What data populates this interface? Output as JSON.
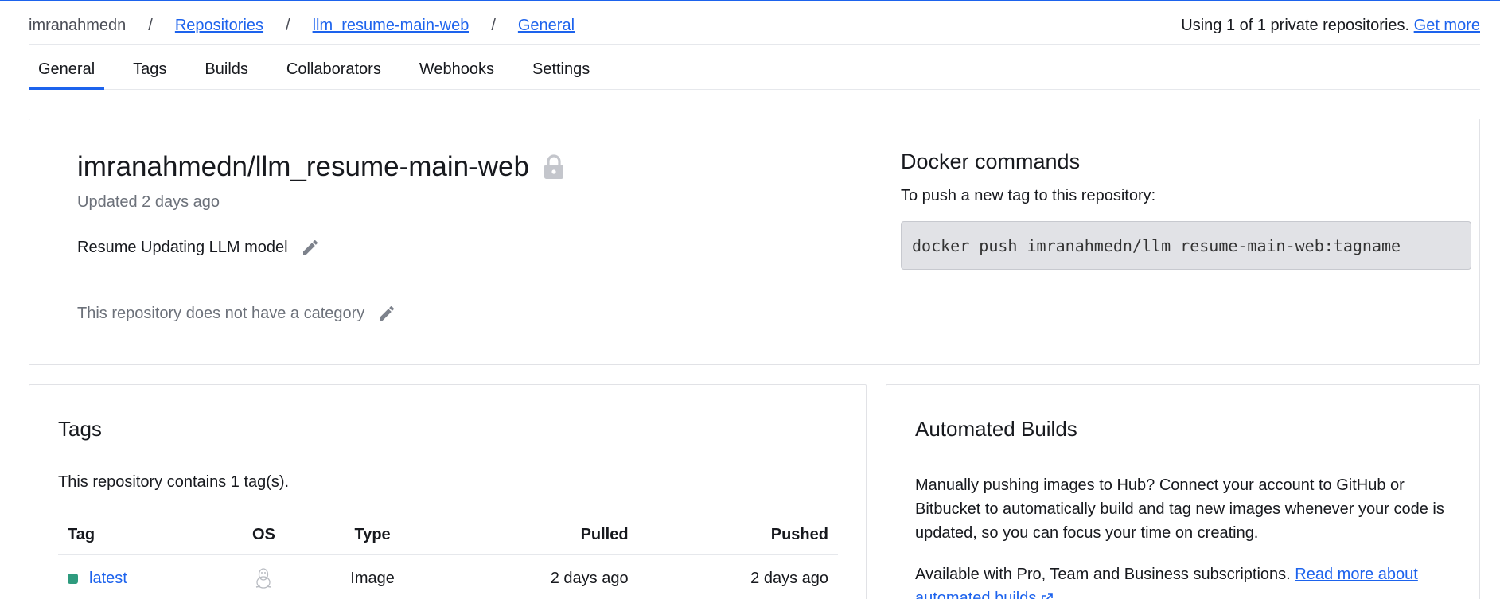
{
  "breadcrumb": {
    "user": "imranahmedn",
    "repositories": "Repositories",
    "repo": "llm_resume-main-web",
    "current": "General",
    "separator": "/"
  },
  "usage": {
    "text": "Using 1 of 1 private repositories.",
    "link": "Get more"
  },
  "tabs": [
    {
      "label": "General",
      "active": true
    },
    {
      "label": "Tags"
    },
    {
      "label": "Builds"
    },
    {
      "label": "Collaborators"
    },
    {
      "label": "Webhooks"
    },
    {
      "label": "Settings"
    }
  ],
  "repo": {
    "full_name": "imranahmedn/llm_resume-main-web",
    "updated": "Updated 2 days ago",
    "description": "Resume Updating LLM model",
    "category": "This repository does not have a category",
    "visibility_icon": "lock-icon"
  },
  "docker": {
    "title": "Docker commands",
    "subtitle": "To push a new tag to this repository:",
    "command": "docker push imranahmedn/llm_resume-main-web:tagname"
  },
  "tags_section": {
    "title": "Tags",
    "count_text": "This repository contains 1 tag(s).",
    "columns": [
      "Tag",
      "OS",
      "Type",
      "Pulled",
      "Pushed"
    ],
    "rows": [
      {
        "tag": "latest",
        "os_icon": "linux-icon",
        "type": "Image",
        "pulled": "2 days ago",
        "pushed": "2 days ago"
      }
    ]
  },
  "builds_section": {
    "title": "Automated Builds",
    "para1": "Manually pushing images to Hub? Connect your account to GitHub or Bitbucket to automatically build and tag new images whenever your code is updated, so you can focus your time on creating.",
    "para2": "Available with Pro, Team and Business subscriptions.",
    "read_more": "Read more about automated builds"
  },
  "colors": {
    "accent": "#1d63ed",
    "status_green": "#2e9b7e",
    "muted_text": "#6c717a"
  }
}
